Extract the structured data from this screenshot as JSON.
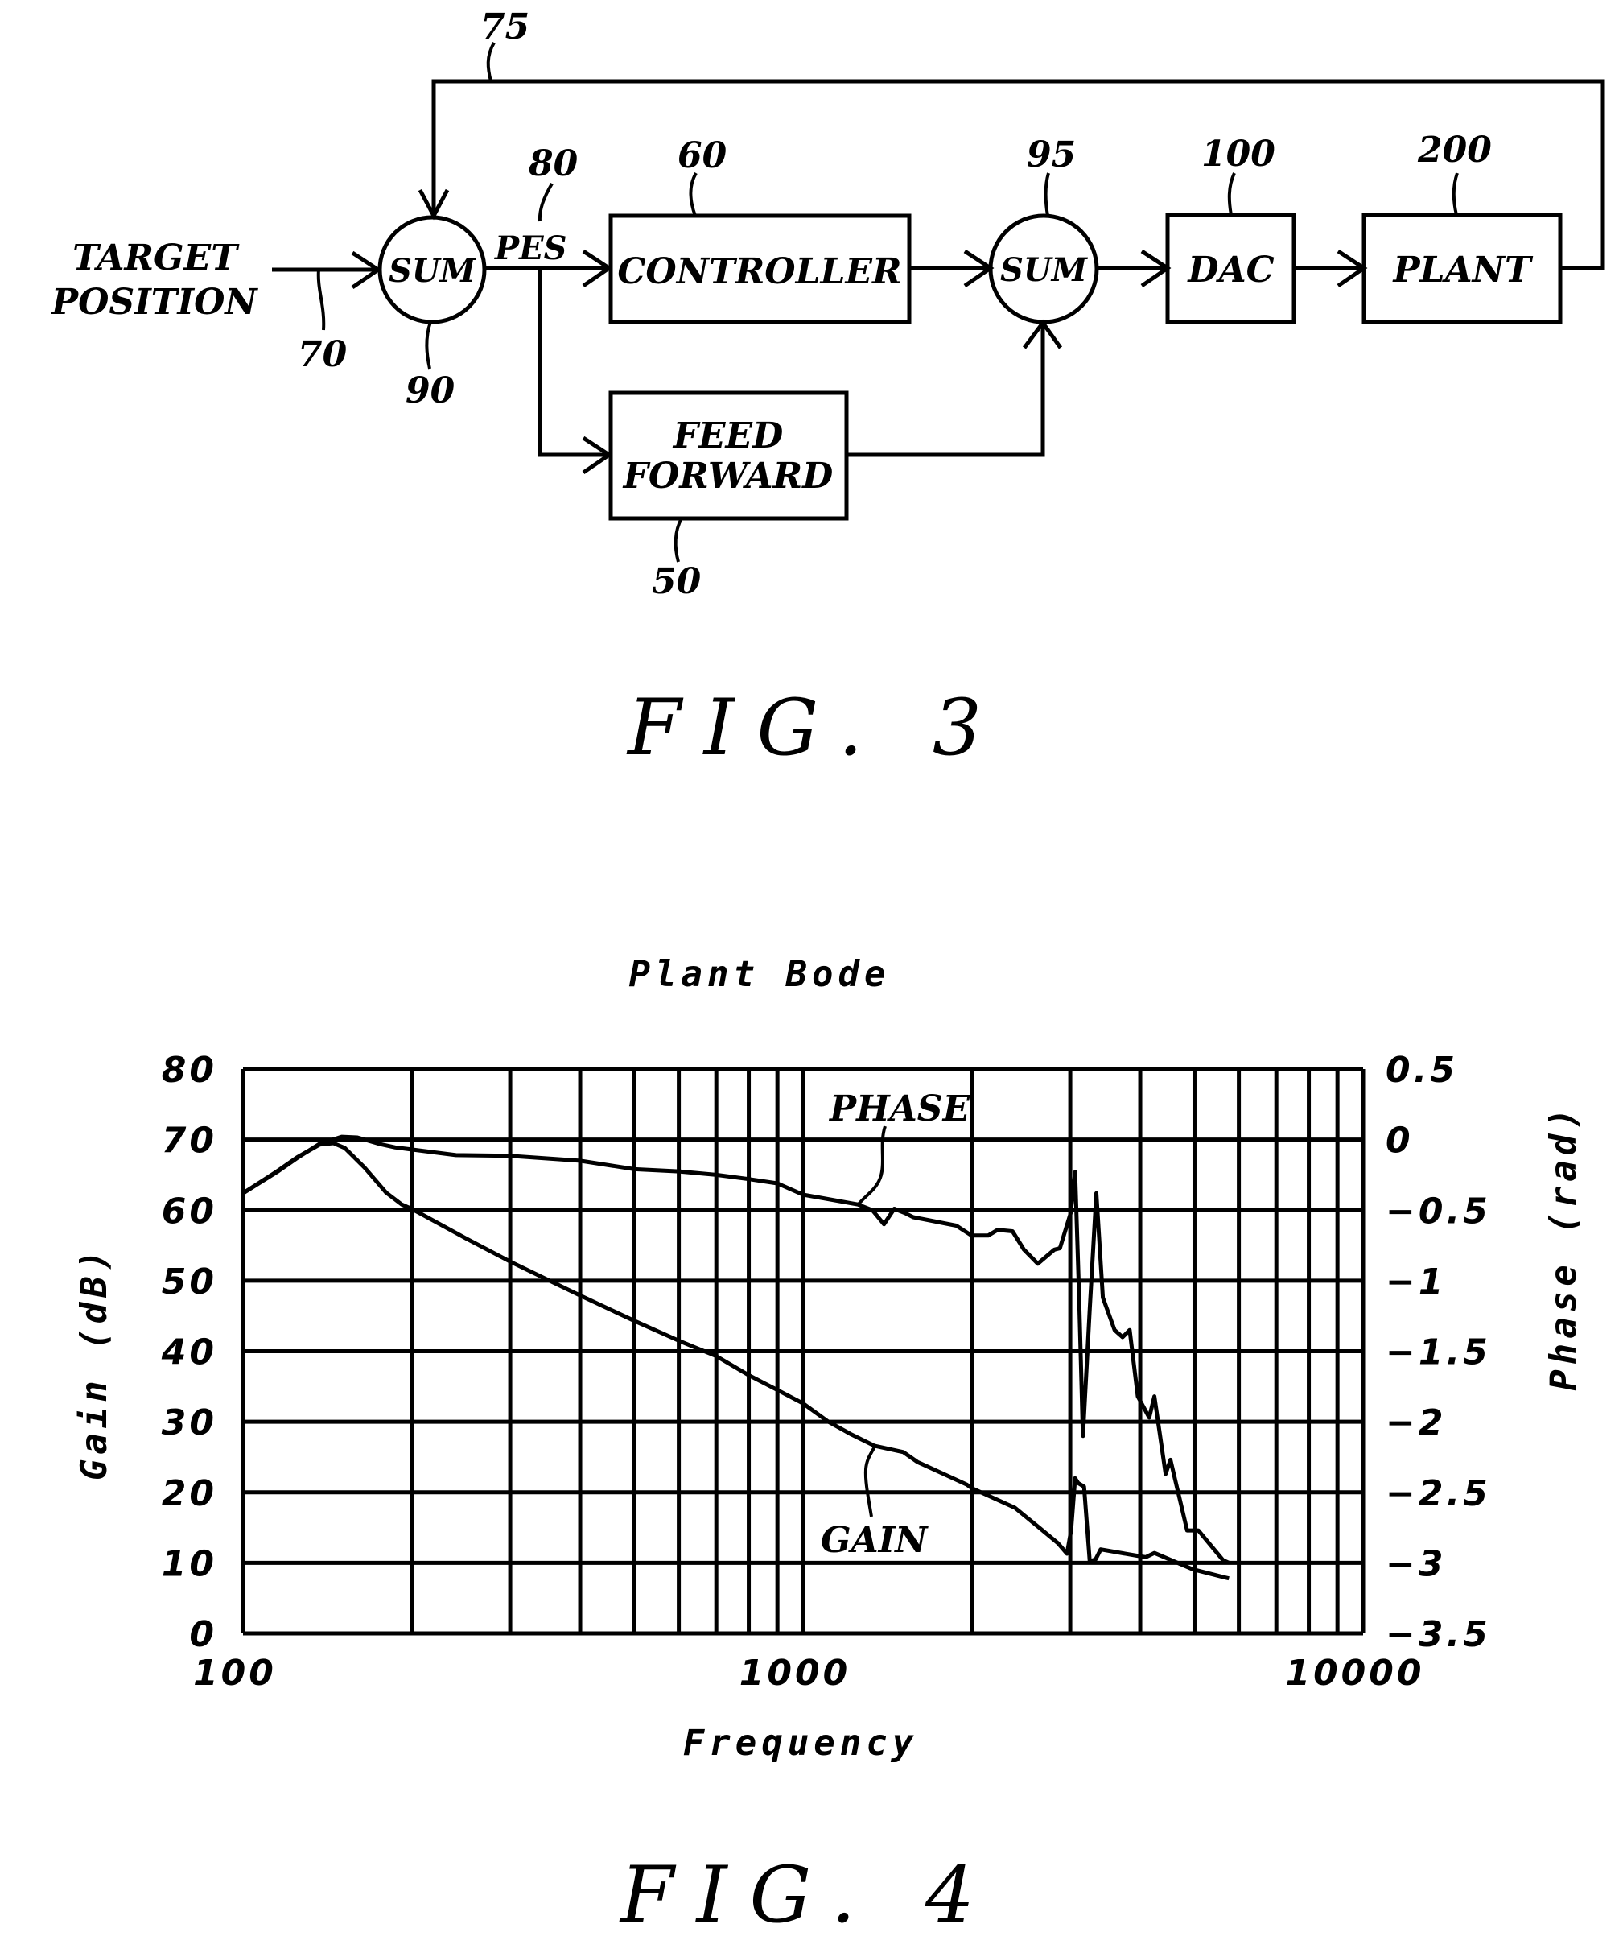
{
  "fig3": {
    "caption": "FIG. 3",
    "target_position": [
      "TARGET",
      "POSITION"
    ],
    "sum1_label": "SUM",
    "sum2_label": "SUM",
    "pes_label": "PES",
    "controller_label": "CONTROLLER",
    "feed_forward_label": [
      "FEED",
      "FORWARD"
    ],
    "dac_label": "DAC",
    "plant_label": "PLANT",
    "refs": {
      "feedback": "75",
      "input": "70",
      "pes": "80",
      "sum1": "90",
      "controller": "60",
      "feed_forward": "50",
      "sum2": "95",
      "dac": "100",
      "plant": "200"
    }
  },
  "fig4": {
    "caption": "FIG. 4"
  },
  "chart_data": {
    "type": "line",
    "title": "Plant Bode",
    "xlabel": "Frequency",
    "ylabel": "Gain (dB)",
    "y2label": "Phase (rad)",
    "xscale": "log",
    "xlim": [
      100,
      10000
    ],
    "ylim": [
      0,
      80
    ],
    "y2lim": [
      -3.5,
      0.5
    ],
    "grid": true,
    "xticks": [
      "100",
      "1000",
      "10000"
    ],
    "yticks": [
      "0",
      "10",
      "20",
      "30",
      "40",
      "50",
      "60",
      "70",
      "80"
    ],
    "y2ticks": [
      "0.5",
      "0",
      "-0.5",
      "-1",
      "-1.5",
      "-2",
      "-2.5",
      "-3",
      "-3.5"
    ],
    "annotations": [
      {
        "text": "PHASE",
        "series": "Phase"
      },
      {
        "text": "GAIN",
        "series": "Gain"
      }
    ],
    "series": [
      {
        "name": "Gain",
        "axis": "left",
        "x": [
          100,
          115,
          125,
          137,
          145,
          152,
          165,
          180,
          192,
          200,
          250,
          300,
          400,
          500,
          600,
          700,
          800,
          900,
          1000,
          1110,
          1220,
          1340,
          1510,
          1600,
          1960,
          2000,
          2390,
          2640,
          2850,
          2960,
          3010,
          3060,
          3100,
          3175,
          3250,
          3330,
          3400,
          4090,
          4240,
          4960,
          5620,
          5760
        ],
        "y": [
          62.4,
          65.5,
          67.5,
          69.3,
          69.5,
          68.8,
          66.0,
          62.5,
          60.8,
          60.2,
          56.0,
          52.7,
          47.9,
          44.3,
          41.5,
          39.3,
          36.6,
          34.5,
          32.6,
          30.0,
          28.2,
          26.6,
          25.7,
          24.3,
          21.1,
          20.6,
          17.8,
          15.0,
          12.8,
          11.3,
          14.6,
          22.0,
          21.3,
          20.8,
          10.2,
          10.5,
          11.9,
          10.8,
          11.4,
          9.1,
          8.0,
          7.8
        ]
      },
      {
        "name": "Phase",
        "axis": "right",
        "x": [
          100,
          115,
          125,
          137,
          150,
          160,
          175,
          187,
          200,
          240,
          300,
          400,
          500,
          600,
          700,
          800,
          900,
          1000,
          1253,
          1330,
          1395,
          1455,
          1520,
          1573,
          1878,
          2000,
          2140,
          2225,
          2366,
          2480,
          2625,
          2810,
          2875,
          3005,
          3060,
          3110,
          3160,
          3250,
          3340,
          3430,
          3600,
          3720,
          3830,
          3960,
          4150,
          4240,
          4440,
          4530,
          4850,
          5080,
          5620,
          5760
        ],
        "y": [
          -0.38,
          -0.23,
          -0.13,
          -0.03,
          0.02,
          0.015,
          -0.03,
          -0.055,
          -0.07,
          -0.11,
          -0.115,
          -0.15,
          -0.21,
          -0.225,
          -0.25,
          -0.28,
          -0.31,
          -0.39,
          -0.46,
          -0.5,
          -0.6,
          -0.49,
          -0.52,
          -0.55,
          -0.61,
          -0.68,
          -0.68,
          -0.64,
          -0.65,
          -0.78,
          -0.88,
          -0.78,
          -0.77,
          -0.52,
          -0.23,
          -1.1,
          -2.1,
          -1.2,
          -0.38,
          -1.12,
          -1.35,
          -1.4,
          -1.35,
          -1.82,
          -1.97,
          -1.82,
          -2.37,
          -2.27,
          -2.77,
          -2.77,
          -2.98,
          -3.0
        ]
      }
    ]
  }
}
